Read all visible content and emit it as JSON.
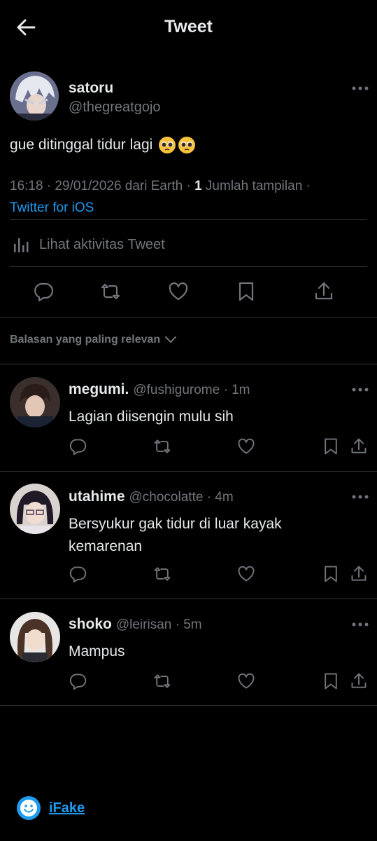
{
  "header": {
    "title": "Tweet"
  },
  "tweet": {
    "name": "satoru",
    "handle": "@thegreatgojo",
    "text": "gue ditinggal tidur lagi",
    "emojis": [
      "pleading-face-emoji",
      "pleading-face-emoji"
    ],
    "meta_prefix": "16:18 · 29/01/2026 dari Earth · ",
    "views_count": "1",
    "views_label": " Jumlah tampilan ·",
    "source": "Twitter for iOS",
    "activity_label": "Lihat aktivitas Tweet"
  },
  "sort_label": "Balasan yang paling relevan",
  "replies": [
    {
      "name": "megumi.",
      "handle": "@fushigurome",
      "time": "· 1m",
      "text": "Lagian diisengin mulu sih"
    },
    {
      "name": "utahime",
      "handle": "@chocolatte",
      "time": "· 4m",
      "text": "Bersyukur gak tidur di luar kayak kemarenan"
    },
    {
      "name": "shoko",
      "handle": "@leirisan",
      "time": "· 5m",
      "text": "Mampus"
    }
  ],
  "footer": {
    "brand": "iFake"
  },
  "colors": {
    "background": "#000000",
    "text": "#e7e9ea",
    "muted": "#71767b",
    "accent": "#1d9bf0",
    "divider": "#2f3336"
  }
}
